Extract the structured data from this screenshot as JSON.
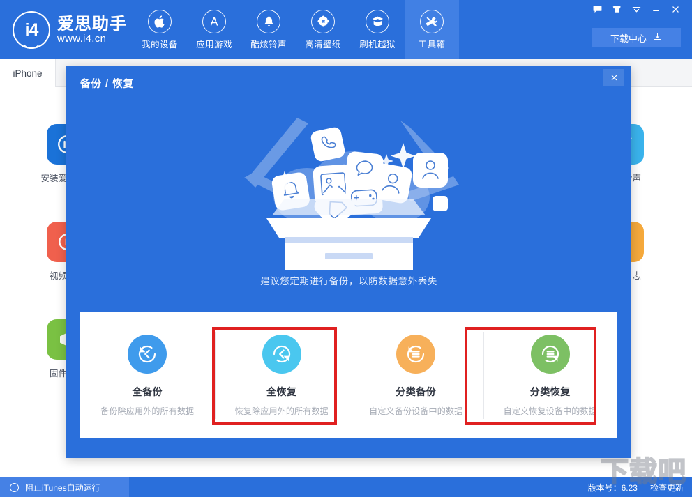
{
  "app": {
    "logo_text": "爱思助手",
    "logo_url": "www.i4.cn",
    "logo_mark": "i4"
  },
  "header": {
    "nav": [
      {
        "label": "我的设备",
        "icon": "apple-icon",
        "active": false
      },
      {
        "label": "应用游戏",
        "icon": "appstore-icon",
        "active": false
      },
      {
        "label": "酷炫铃声",
        "icon": "bell-icon",
        "active": false
      },
      {
        "label": "高清壁纸",
        "icon": "flower-icon",
        "active": false
      },
      {
        "label": "刷机越狱",
        "icon": "box-open-icon",
        "active": false
      },
      {
        "label": "工具箱",
        "icon": "tools-icon",
        "active": true
      }
    ],
    "window_buttons": [
      {
        "name": "message-icon",
        "title": "消息"
      },
      {
        "name": "skin-icon",
        "title": "皮肤"
      },
      {
        "name": "chevron-down-icon",
        "title": "菜单"
      },
      {
        "name": "minimize-icon",
        "title": "最小化"
      },
      {
        "name": "close-icon",
        "title": "关闭"
      }
    ],
    "download_center": "下载中心"
  },
  "tabstrip": {
    "device_tab": "iPhone"
  },
  "background_tiles": [
    {
      "label": "安装爱思助手",
      "color": "#1a72d8",
      "icon": "i4-app-icon"
    },
    {
      "label": "视频教程",
      "color": "#f0604d",
      "icon": "video-icon"
    },
    {
      "label": "固件下载",
      "color": "#7ac143",
      "icon": "firmware-icon"
    },
    {
      "label": "制作铃声",
      "color": "#3ab3ec",
      "icon": "ringtone-make-icon"
    },
    {
      "label": "系统日志",
      "color": "#f5a93c",
      "icon": "log-icon"
    }
  ],
  "modal": {
    "title": "备份 / 恢复",
    "close_label": "×",
    "tagline": "建议您定期进行备份，以防数据意外丢失",
    "cards": [
      {
        "title": "全备份",
        "desc": "备份除应用外的所有数据",
        "color": "#3f9bec",
        "icon": "backup-all-icon",
        "highlighted": false
      },
      {
        "title": "全恢复",
        "desc": "恢复除应用外的所有数据",
        "color": "#4ac7ef",
        "icon": "restore-all-icon",
        "highlighted": true
      },
      {
        "title": "分类备份",
        "desc": "自定义备份设备中的数据",
        "color": "#f7b05a",
        "icon": "backup-category-icon",
        "highlighted": false
      },
      {
        "title": "分类恢复",
        "desc": "自定义恢复设备中的数据",
        "color": "#7dc064",
        "icon": "restore-category-icon",
        "highlighted": true
      }
    ]
  },
  "statusbar": {
    "block_itunes": "阻止iTunes自动运行",
    "version": "版本号：6.23",
    "check_update": "检查更新"
  },
  "watermark": {
    "text": "下载吧"
  },
  "colors": {
    "brand_blue": "#2a6fdb",
    "nav_active": "#4180e4",
    "highlight_red": "#e02020",
    "panel_white": "#ffffff"
  }
}
